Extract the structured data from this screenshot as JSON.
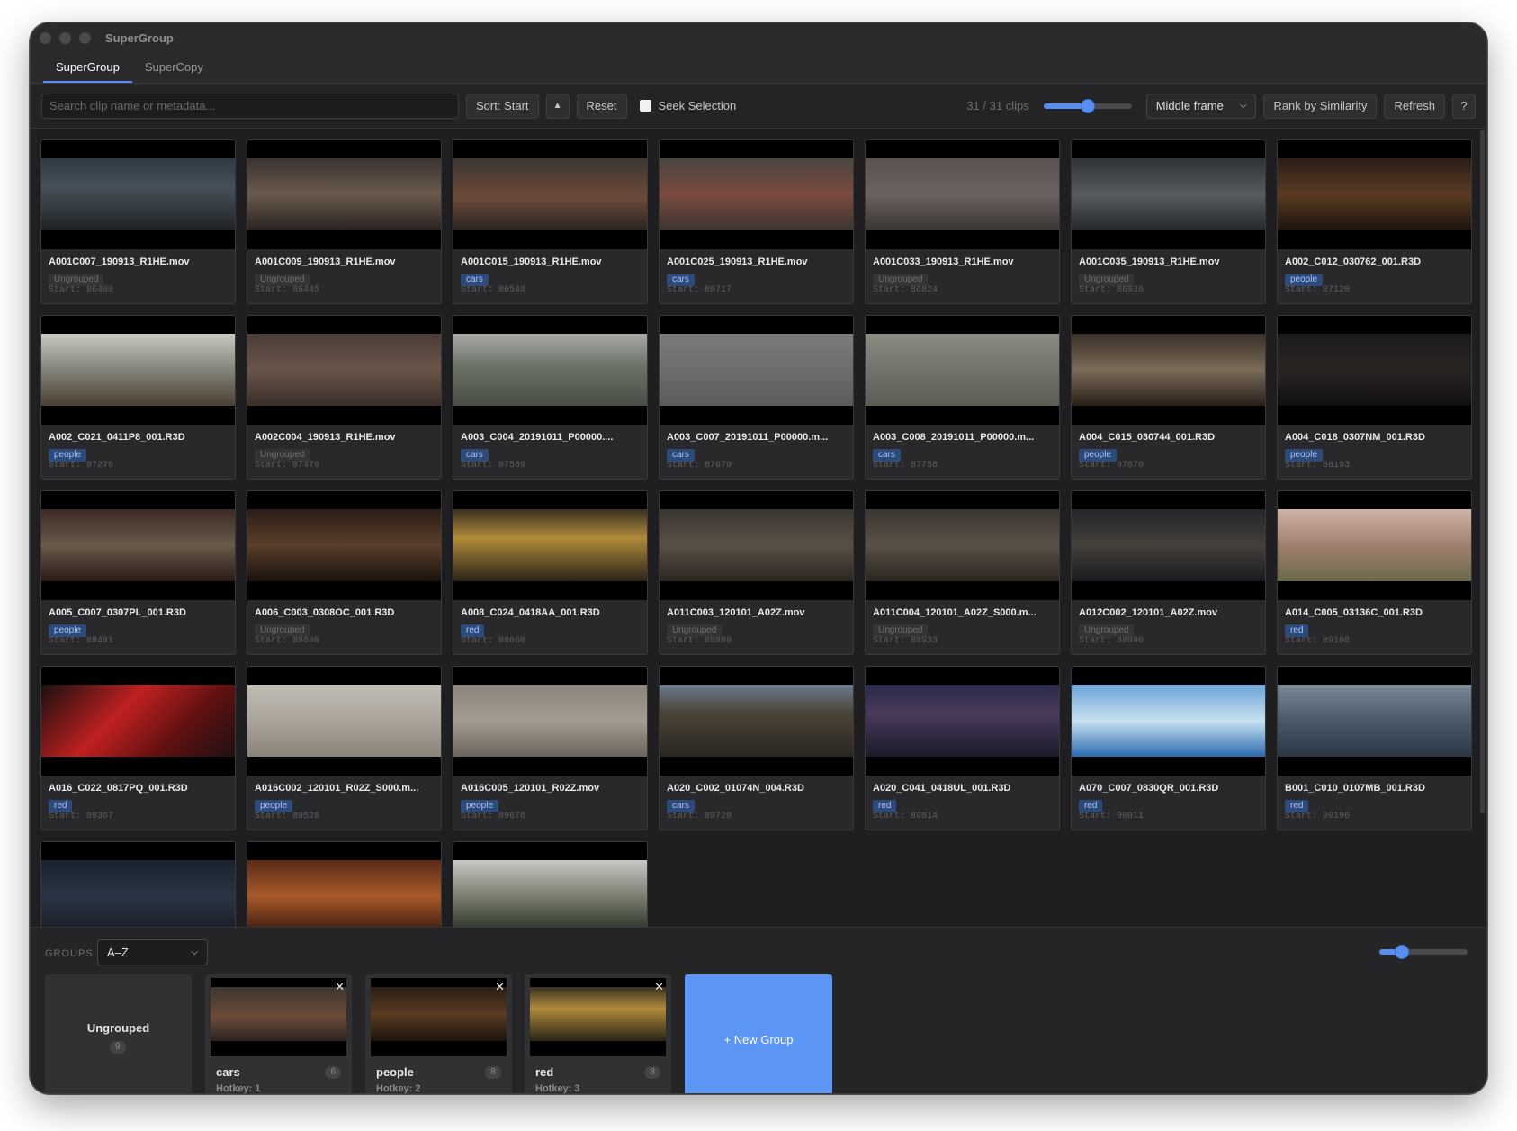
{
  "app": {
    "title": "SuperGroup"
  },
  "tabs": [
    {
      "label": "SuperGroup",
      "active": true
    },
    {
      "label": "SuperCopy",
      "active": false
    }
  ],
  "toolbar": {
    "search_placeholder": "Search clip name or metadata...",
    "sort_label": "Sort: Start",
    "sort_dir_icon": "▲",
    "reset_label": "Reset",
    "seek_label": "Seek Selection",
    "seek_checked": false,
    "clip_count": "31 / 31 clips",
    "thumb_size_level": 0.5,
    "frame_select": "Middle frame",
    "rank_label": "Rank by Similarity",
    "refresh_label": "Refresh",
    "help_label": "?"
  },
  "colors": {
    "accent": "#5a8df0",
    "new_group": "#5b95f5",
    "tag_bg": "#2c4a7a",
    "tag_text": "#a9c6ff",
    "window_bg": "#1d1d1f"
  },
  "clips": [
    {
      "name": "A001C007_190913_R1HE.mov",
      "tag": "Ungrouped",
      "start": "Start: 86400",
      "thumb": "linear-gradient(180deg,#2d3942 0%,#46505a 40%,#1e2226 100%)"
    },
    {
      "name": "A001C009_190913_R1HE.mov",
      "tag": "Ungrouped",
      "start": "Start: 86445",
      "thumb": "linear-gradient(180deg,#3a3330 0%,#6a5a4c 50%,#2a2220 100%)"
    },
    {
      "name": "A001C015_190913_R1HE.mov",
      "tag": "cars",
      "start": "Start: 86548",
      "thumb": "linear-gradient(180deg,#3c3630 0%,#6c4a3a 55%,#2a2420 100%)"
    },
    {
      "name": "A001C025_190913_R1HE.mov",
      "tag": "cars",
      "start": "Start: 86717",
      "thumb": "linear-gradient(180deg,#4a4640 0%,#7a4a40 50%,#3a3430 100%)"
    },
    {
      "name": "A001C033_190913_R1HE.mov",
      "tag": "Ungrouped",
      "start": "Start: 86824",
      "thumb": "linear-gradient(180deg,#5a5250 0%,#6a6260 50%,#3a3432 100%)"
    },
    {
      "name": "A001C035_190913_R1HE.mov",
      "tag": "Ungrouped",
      "start": "Start: 86936",
      "thumb": "linear-gradient(180deg,#2e3236 0%,#585c60 50%,#24282c 100%)"
    },
    {
      "name": "A002_C012_030762_001.R3D",
      "tag": "people",
      "start": "Start: 87120",
      "thumb": "linear-gradient(180deg,#2a1e16 0%,#5a3a22 50%,#1c140e 100%)"
    },
    {
      "name": "A002_C021_0411P8_001.R3D",
      "tag": "people",
      "start": "Start: 87276",
      "thumb": "linear-gradient(180deg,#c8c8c0 0%,#8a8a80 45%,#4a4032 100%)"
    },
    {
      "name": "A002C004_190913_R1HE.mov",
      "tag": "Ungrouped",
      "start": "Start: 87479",
      "thumb": "linear-gradient(180deg,#4a3e38 0%,#6a5448 50%,#3a2e28 100%)"
    },
    {
      "name": "A003_C004_20191011_P00000....",
      "tag": "cars",
      "start": "Start: 87589",
      "thumb": "linear-gradient(180deg,#a8aaa6 0%,#6a7266 45%,#4a4e46 100%)"
    },
    {
      "name": "A003_C007_20191011_P00000.m...",
      "tag": "cars",
      "start": "Start: 87679",
      "thumb": "linear-gradient(180deg,#7a7c7a 0%,#6c6e6c 50%,#5a5c5a 100%)"
    },
    {
      "name": "A003_C008_20191011_P00000.m...",
      "tag": "cars",
      "start": "Start: 87758",
      "thumb": "linear-gradient(180deg,#8a8c84 0%,#70746a 50%,#5a5e54 100%)"
    },
    {
      "name": "A004_C015_030744_001.R3D",
      "tag": "people",
      "start": "Start: 87870",
      "thumb": "linear-gradient(180deg,#3a3028 0%,#7a6a58 50%,#2a2018 100%)"
    },
    {
      "name": "A004_C018_0307NM_001.R3D",
      "tag": "people",
      "start": "Start: 88193",
      "thumb": "linear-gradient(180deg,#1a1a1c 0%,#2a2422 50%,#101010 100%)"
    },
    {
      "name": "A005_C007_0307PL_001.R3D",
      "tag": "people",
      "start": "Start: 88481",
      "thumb": "linear-gradient(180deg,#3a2a22 0%,#6a5a4a 50%,#2a1a14 100%)"
    },
    {
      "name": "A006_C003_0308OC_001.R3D",
      "tag": "Ungrouped",
      "start": "Start: 88600",
      "thumb": "linear-gradient(180deg,#2a1e18 0%,#5a3e2a 50%,#1a120c 100%)"
    },
    {
      "name": "A008_C024_0418AA_001.R3D",
      "tag": "red",
      "start": "Start: 88660",
      "thumb": "linear-gradient(180deg,#3a3020 0%,#b08a3a 40%,#2a2418 100%)"
    },
    {
      "name": "A011C003_120101_A02Z.mov",
      "tag": "Ungrouped",
      "start": "Start: 88889",
      "thumb": "linear-gradient(180deg,#3a3630 0%,#5a5046 50%,#2a2620 100%)"
    },
    {
      "name": "A011C004_120101_A02Z_S000.m...",
      "tag": "Ungrouped",
      "start": "Start: 88933",
      "thumb": "linear-gradient(180deg,#3a3630 0%,#5a5046 50%,#2a2620 100%)"
    },
    {
      "name": "A012C002_120101_A02Z.mov",
      "tag": "Ungrouped",
      "start": "Start: 88996",
      "thumb": "linear-gradient(180deg,#24242a 0%,#44403a 50%,#1a1a1e 100%)"
    },
    {
      "name": "A014_C005_03136C_001.R3D",
      "tag": "red",
      "start": "Start: 89108",
      "thumb": "linear-gradient(180deg,#d0b4a8 0%,#a08070 50%,#6a6a4a 100%)"
    },
    {
      "name": "A016_C022_0817PQ_001.R3D",
      "tag": "red",
      "start": "Start: 89367",
      "thumb": "linear-gradient(135deg,#1a1010 0%,#c02020 40%,#601010 70%,#201010 100%)"
    },
    {
      "name": "A016C002_120101_R02Z_S000.m...",
      "tag": "people",
      "start": "Start: 89526",
      "thumb": "linear-gradient(180deg,#c0bcb4 0%,#aaa49a 50%,#8a847a 100%)"
    },
    {
      "name": "A016C005_120101_R02Z.mov",
      "tag": "people",
      "start": "Start: 89676",
      "thumb": "linear-gradient(180deg,#8a847c 0%,#a49c90 50%,#6a645c 100%)"
    },
    {
      "name": "A020_C002_01074N_004.R3D",
      "tag": "cars",
      "start": "Start: 89720",
      "thumb": "linear-gradient(180deg,#6a7a8a 0%,#4a4438 40%,#2a2620 100%)"
    },
    {
      "name": "A020_C041_0418UL_001.R3D",
      "tag": "red",
      "start": "Start: 89814",
      "thumb": "linear-gradient(180deg,#2a2a4a 0%,#4a3a5a 40%,#1a1a2a 100%)"
    },
    {
      "name": "A070_C007_0830QR_001.R3D",
      "tag": "red",
      "start": "Start: 90011",
      "thumb": "linear-gradient(180deg,#6aa4d8 0%,#c8e0f0 50%,#2a6ab0 100%)"
    },
    {
      "name": "B001_C010_0107MB_001.R3D",
      "tag": "red",
      "start": "Start: 90196",
      "thumb": "linear-gradient(180deg,#7a8898 0%,#4a5868 50%,#2a3644 100%)"
    },
    {
      "name": "",
      "tag": "",
      "start": "",
      "thumb": "linear-gradient(180deg,#1a2230 0%,#2a3444 50%,#1a1e24 100%)"
    },
    {
      "name": "",
      "tag": "",
      "start": "",
      "thumb": "linear-gradient(180deg,#5a2a18 0%,#a85a2a 50%,#3a1a10 100%)"
    },
    {
      "name": "",
      "tag": "",
      "start": "",
      "thumb": "linear-gradient(180deg,#c8c8c4 0%,#6a7060 60%,#2a2e26 100%)"
    }
  ],
  "groups_bar": {
    "label": "GROUPS",
    "sort_select": "A–Z",
    "size_level": 0.25,
    "ungrouped": {
      "label": "Ungrouped",
      "count": "9"
    },
    "groups": [
      {
        "name": "cars",
        "count": "6",
        "hotkey": "Hotkey: 1",
        "thumb": "linear-gradient(180deg,#3c3630 0%,#6c4a3a 55%,#2a2420 100%)"
      },
      {
        "name": "people",
        "count": "8",
        "hotkey": "Hotkey: 2",
        "thumb": "linear-gradient(180deg,#2a1e16 0%,#5a3a22 50%,#1c140e 100%)"
      },
      {
        "name": "red",
        "count": "8",
        "hotkey": "Hotkey: 3",
        "thumb": "linear-gradient(180deg,#3a3020 0%,#b08a3a 40%,#2a2418 100%)"
      }
    ],
    "new_group_label": "+ New Group"
  }
}
